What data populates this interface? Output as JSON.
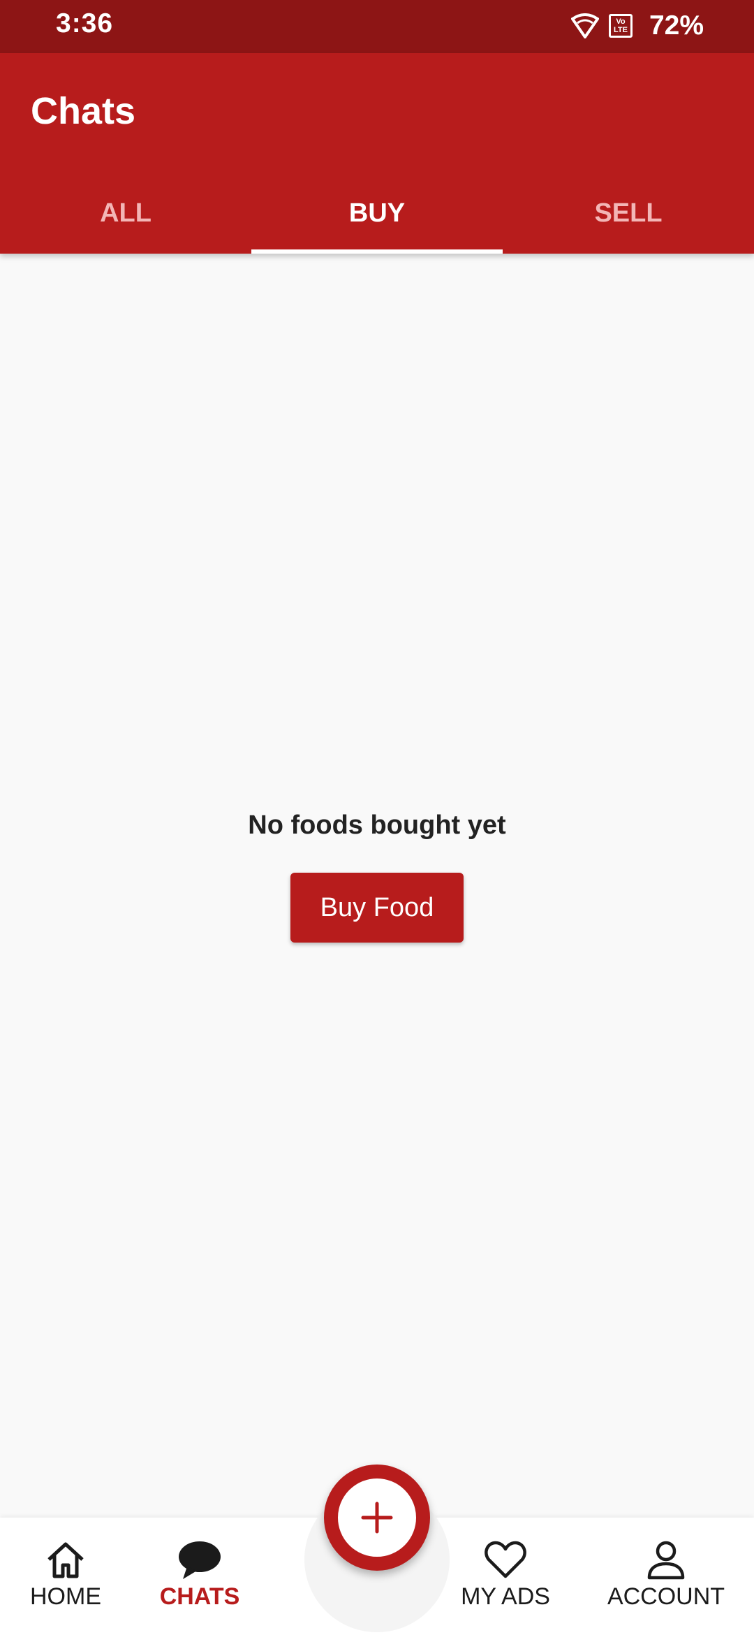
{
  "status_bar": {
    "time": "3:36",
    "battery": "72%",
    "icons": [
      "wifi-icon",
      "volte-icon"
    ],
    "volte_text": "Vo LTE"
  },
  "header": {
    "title": "Chats",
    "tabs": [
      {
        "label": "ALL",
        "active": false
      },
      {
        "label": "BUY",
        "active": true
      },
      {
        "label": "SELL",
        "active": false
      }
    ]
  },
  "empty_state": {
    "message": "No foods bought yet",
    "button_label": "Buy Food"
  },
  "bottom_nav": {
    "items": [
      {
        "label": "HOME",
        "icon": "home-icon",
        "active": false
      },
      {
        "label": "CHATS",
        "icon": "chat-icon",
        "active": true
      },
      {
        "label": "MY ADS",
        "icon": "heart-icon",
        "active": false
      },
      {
        "label": "ACCOUNT",
        "icon": "person-icon",
        "active": false
      }
    ],
    "fab_icon": "plus-icon"
  },
  "colors": {
    "primary": "#b71c1c",
    "status_bar": "#8d1515",
    "background": "#f9f9f9",
    "inactive_tab": "#f3b6b6"
  }
}
